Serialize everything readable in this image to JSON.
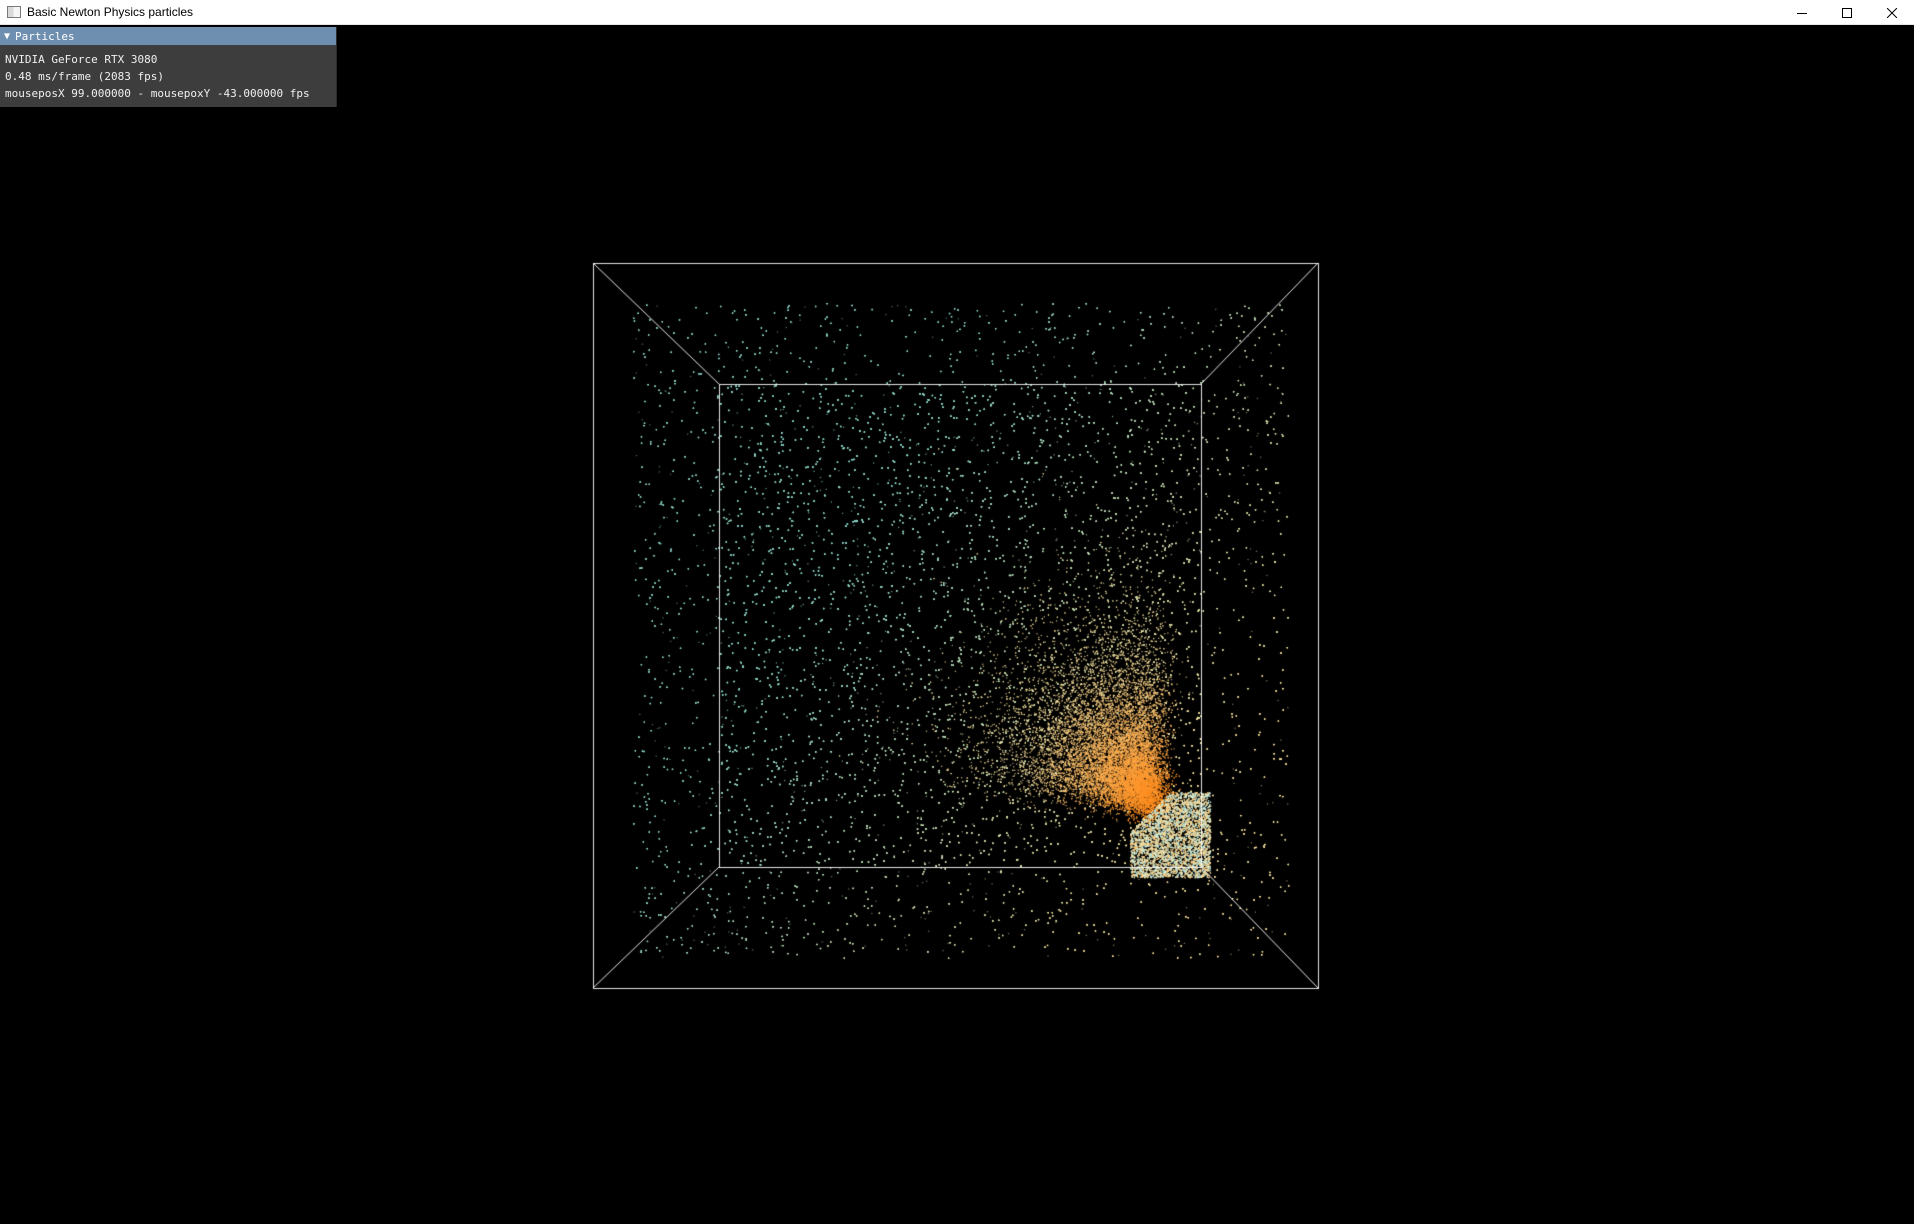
{
  "window": {
    "title": "Basic Newton Physics particles",
    "controls": [
      "minimize",
      "maximize",
      "close"
    ]
  },
  "overlay": {
    "header": "Particles",
    "lines": [
      "NVIDIA GeForce RTX 3080",
      "0.48 ms/frame (2083 fps)",
      "mouseposX 99.000000 - mousepoxY -43.000000 fps"
    ]
  },
  "scene": {
    "background": "#000000",
    "box_color": "#ffffff",
    "particle_colors": {
      "cool": "#8fd6c8",
      "warm": "#f7e3a0",
      "hot": "#ff8a1a"
    }
  }
}
